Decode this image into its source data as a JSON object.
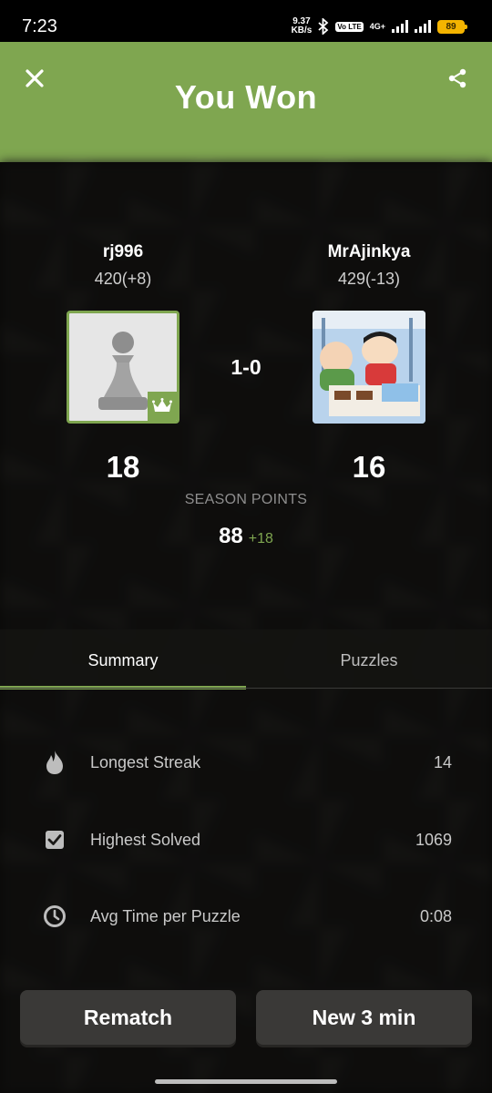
{
  "status_bar": {
    "time": "7:23",
    "net_speed_value": "9.37",
    "net_speed_unit": "KB/s",
    "volte": "Vo LTE",
    "network_gen": "4G+",
    "battery": "89"
  },
  "header": {
    "title": "You Won",
    "color": "#7fa650"
  },
  "players": {
    "left": {
      "name": "rj996",
      "rating": "420(+8)",
      "points": "18",
      "winner": true
    },
    "right": {
      "name": "MrAjinkya",
      "rating": "429(-13)",
      "points": "16"
    }
  },
  "score": "1-0",
  "season": {
    "label": "SEASON POINTS",
    "total": "88",
    "delta": "+18"
  },
  "tabs": [
    {
      "label": "Summary",
      "active": true
    },
    {
      "label": "Puzzles",
      "active": false
    }
  ],
  "stats": [
    {
      "icon": "flame-icon",
      "label": "Longest Streak",
      "value": "14"
    },
    {
      "icon": "checkbox-icon",
      "label": "Highest Solved",
      "value": "1069"
    },
    {
      "icon": "clock-icon",
      "label": "Avg Time per Puzzle",
      "value": "0:08"
    }
  ],
  "actions": {
    "rematch": "Rematch",
    "new_game": "New 3 min"
  }
}
